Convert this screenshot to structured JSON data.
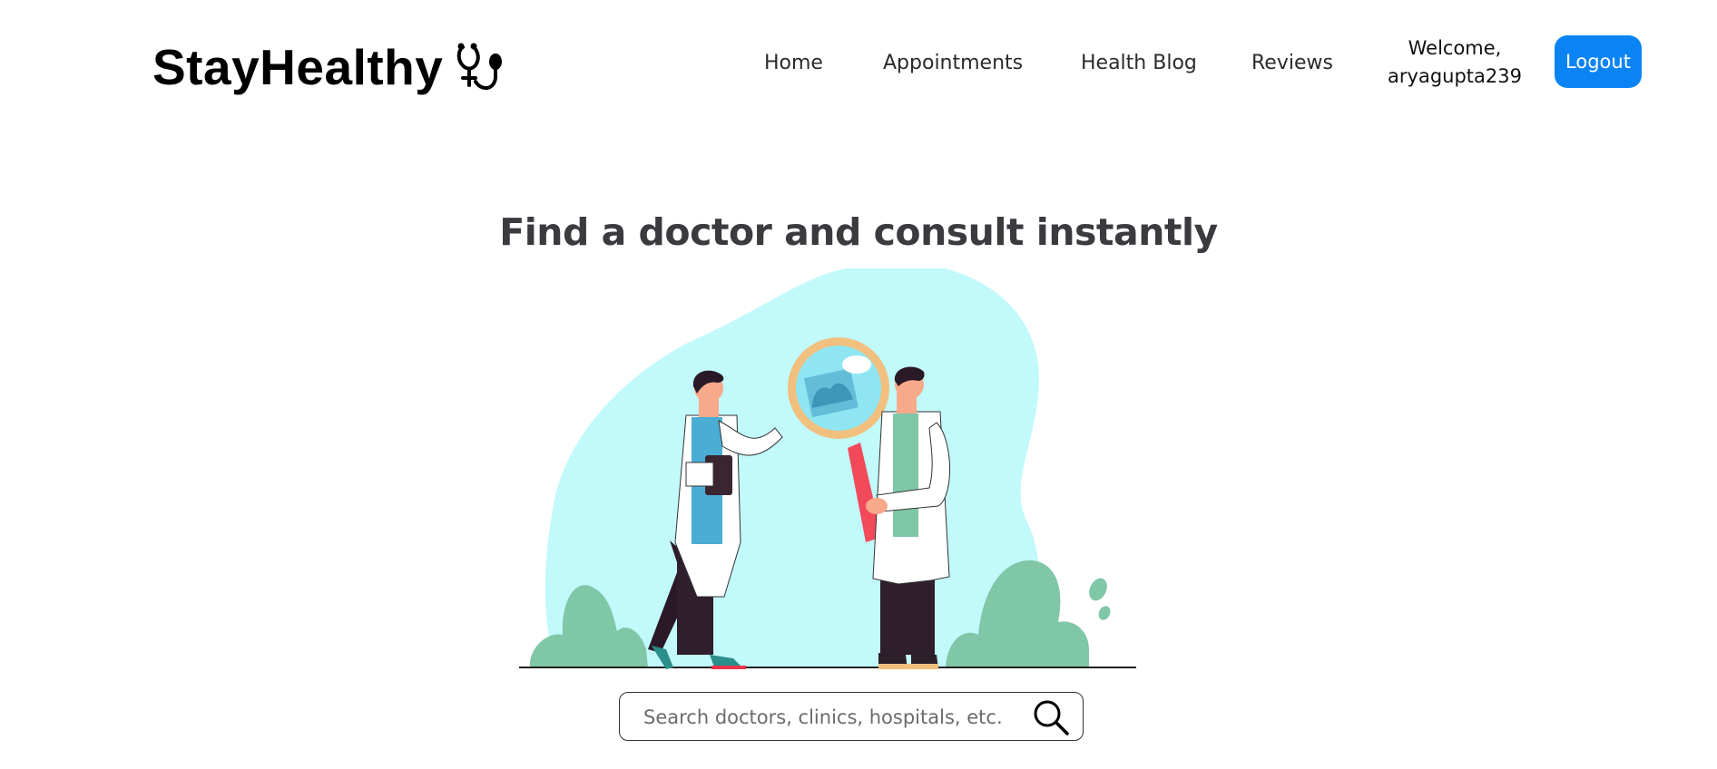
{
  "brand": {
    "name": "StayHealthy",
    "icon": "stethoscope-icon"
  },
  "nav": {
    "links": [
      "Home",
      "Appointments",
      "Health Blog",
      "Reviews"
    ],
    "welcome_line1": "Welcome,",
    "welcome_line2": "aryagupta239",
    "logout_label": "Logout"
  },
  "hero": {
    "title": "Find a doctor and consult instantly"
  },
  "search": {
    "placeholder": "Search doctors, clinics, hospitals, etc.",
    "icon": "search-icon"
  },
  "colors": {
    "accent": "#0a84f5",
    "blob": "#c2f9fb",
    "bush": "#7fc7a6",
    "title": "#3a3a3f"
  }
}
